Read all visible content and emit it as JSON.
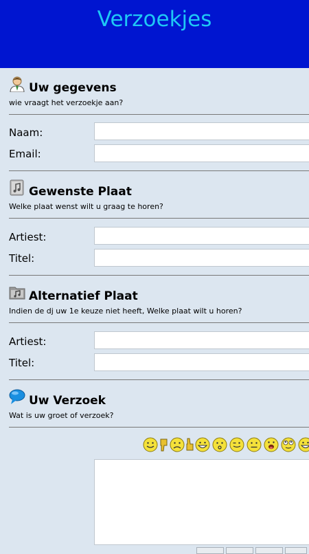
{
  "header": {
    "title": "Verzoekjes"
  },
  "sections": [
    {
      "title": "Uw gegevens",
      "subtitle": "wie vraagt het verzoekje aan?",
      "icon": "person-icon",
      "fields": [
        {
          "label": "Naam:",
          "value": ""
        },
        {
          "label": "Email:",
          "value": ""
        }
      ]
    },
    {
      "title": "Gewenste Plaat",
      "subtitle": "Welke plaat wenst wilt u graag te horen?",
      "icon": "music-note-icon",
      "fields": [
        {
          "label": "Artiest:",
          "value": ""
        },
        {
          "label": "Titel:",
          "value": ""
        }
      ]
    },
    {
      "title": "Alternatief Plaat",
      "subtitle": "Indien de dj uw 1e keuze niet heeft, Welke plaat wilt u horen?",
      "icon": "folder-music-icon",
      "fields": [
        {
          "label": "Artiest:",
          "value": ""
        },
        {
          "label": "Titel:",
          "value": ""
        }
      ]
    },
    {
      "title": "Uw Verzoek",
      "subtitle": "Wat is uw groet of verzoek?",
      "icon": "speech-bubble-icon"
    }
  ],
  "message": {
    "value": ""
  },
  "smileys": [
    "smile-icon",
    "thumbs-down-icon",
    "sad-icon",
    "thumbs-up-grin-icon",
    "grin-icon",
    "surprised-icon",
    "wink-icon",
    "neutral-icon",
    "tongue-icon",
    "eyes-rolling-icon",
    "laugh-icon"
  ],
  "colors": {
    "header_bg": "#0015d0",
    "title": "#1ec8f5",
    "page_bg": "#dce6f0"
  }
}
